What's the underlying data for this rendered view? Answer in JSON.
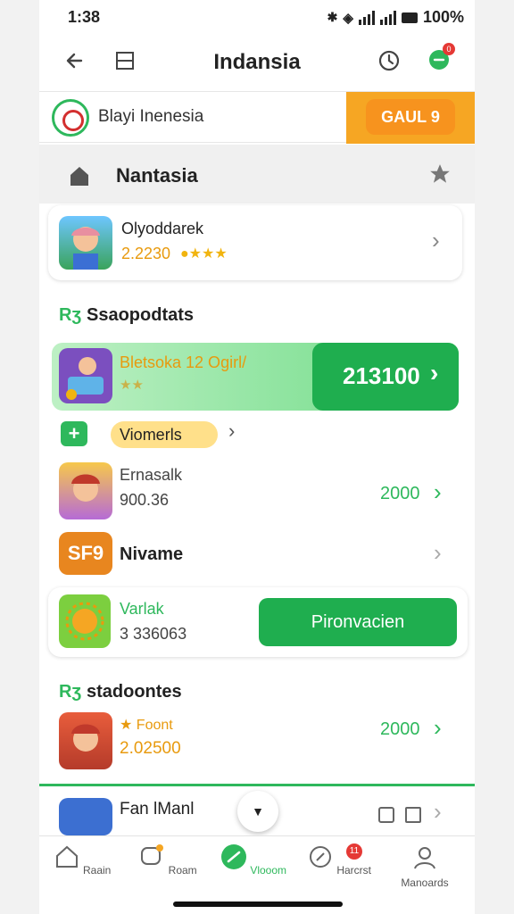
{
  "status": {
    "time": "1:38",
    "battery": "100%"
  },
  "topbar": {
    "title": "Indansia",
    "notif_count": "0"
  },
  "banner": {
    "label": "Blayi Inenesia",
    "promo": "GAUL 9"
  },
  "section": {
    "label": "Nantasia"
  },
  "featured": {
    "name": "Olyoddarek",
    "price": "2.2230"
  },
  "heading1": {
    "rk": "Rʒ",
    "label": "Ssaopodtats"
  },
  "highlight": {
    "title": "Bletsoka 12 Ogirl/",
    "button": "213100"
  },
  "chip": {
    "label": "Viomerls"
  },
  "list": [
    {
      "name": "Ernasalk",
      "sub": "900.36",
      "value": "2000"
    },
    {
      "name": "Nivame",
      "thumb_text": "SF9"
    },
    {
      "name": "Varlak",
      "sub": "3 336063",
      "button": "Pironvacien"
    }
  ],
  "heading2": {
    "rk": "Rʒ",
    "label": "stadoontes"
  },
  "list2": [
    {
      "name": "Foont",
      "sub": "2.02500",
      "value": "2000"
    },
    {
      "name": "Fan lManl"
    }
  ],
  "bottom_nav": [
    "Raain",
    "Roam",
    "Vlooom",
    "Harcrst",
    "Manoards"
  ],
  "nav_badge": "11",
  "colors": {
    "accent": "#2eb85c",
    "promo": "#f6a623",
    "alert": "#e53935"
  }
}
